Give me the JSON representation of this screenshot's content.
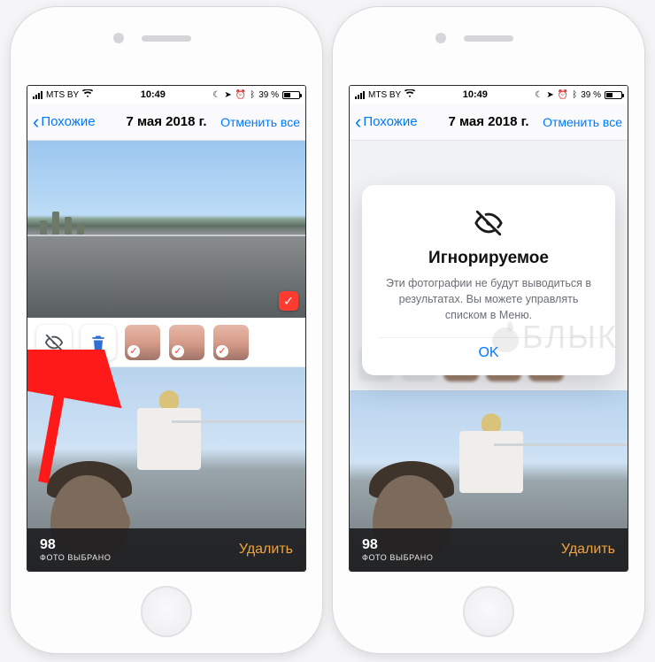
{
  "status": {
    "carrier": "MTS BY",
    "time": "10:49",
    "battery_text": "39 %"
  },
  "nav": {
    "back_label": "Похожие",
    "title": "7 мая 2018 г.",
    "cancel_all": "Отменить все"
  },
  "footer": {
    "count": "98",
    "count_label": "ФОТО ВЫБРАНО",
    "delete": "Удалить"
  },
  "modal": {
    "title": "Игнорируемое",
    "body": "Эти фотографии не будут выводиться в результатах. Вы можете управлять списком в Меню.",
    "ok": "OK"
  },
  "icons": {
    "hide": "hide-icon",
    "trash": "trash-icon"
  },
  "watermark": "БЛЫК"
}
